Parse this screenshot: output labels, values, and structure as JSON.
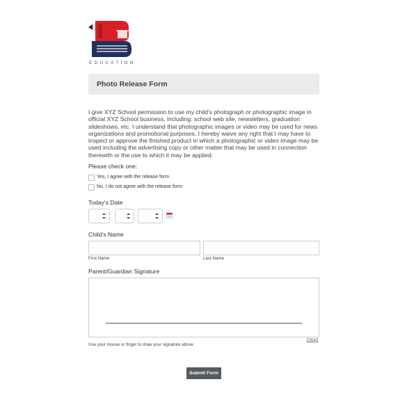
{
  "logo": {
    "text": "EDUCATION"
  },
  "form": {
    "title": "Photo Release Form",
    "intro": "I give XYZ School permission to use my child's photograph or photographic image in official XYZ School business, including: school web site, newsletters, graduation slideshows, etc. I understand that photographic images or video may be used for news organizations and promotional purposes. I hereby waive any right that I may have to inspect or approve the finished product in which a photographic or video image may be used including the advertising copy or other matter that may be used in connection therewith or the use to which it may be applied."
  },
  "consent": {
    "label": "Please check one:",
    "options": [
      "Yes, I agree with the release form",
      "No, I do not agree with the release form"
    ]
  },
  "date": {
    "label": "Today's Date",
    "selects": [
      "",
      "",
      ""
    ]
  },
  "child": {
    "label": "Child's Name",
    "first_caption": "First Name",
    "last_caption": "Last Name",
    "first_value": "",
    "last_value": ""
  },
  "signature": {
    "label": "Parent/Guardian Signature",
    "clear_label": "[clear]",
    "help": "Use your mouse or finger to draw your signature above"
  },
  "submit_label": "Submit Form",
  "colors": {
    "logo_red": "#d72028",
    "logo_navy": "#22305e",
    "button": "#555a60"
  },
  "icons": {
    "calendar": "calendar-icon",
    "pencil": "pencil-icon",
    "books": "books-icon"
  }
}
